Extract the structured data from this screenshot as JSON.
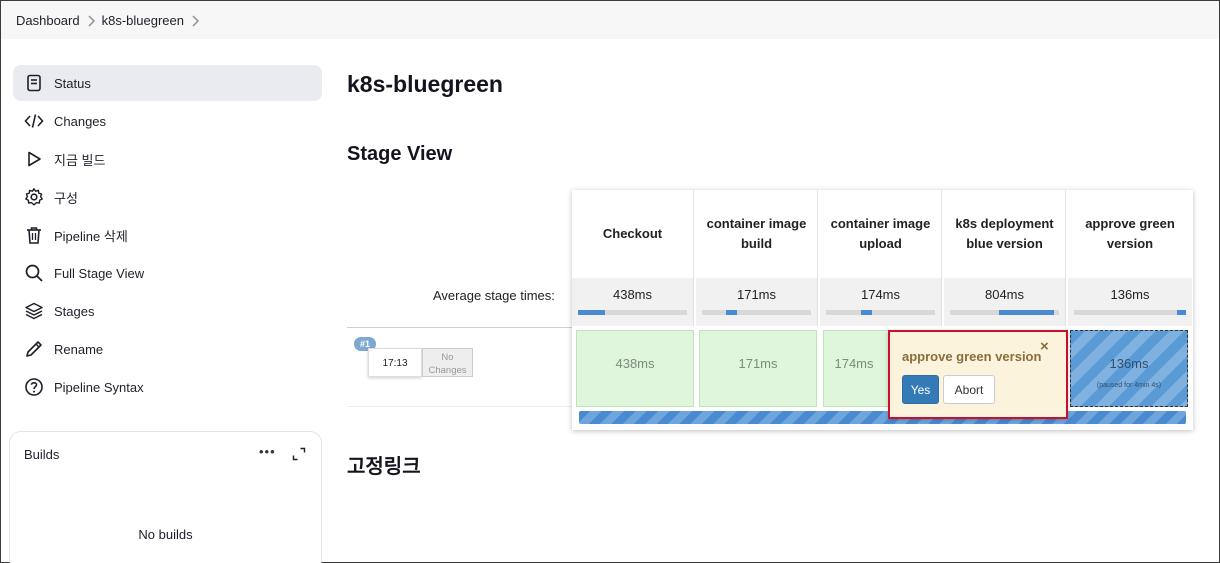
{
  "breadcrumb": [
    "Dashboard",
    "k8s-bluegreen"
  ],
  "sidebar": {
    "items": [
      {
        "label": "Status",
        "icon": "document-icon"
      },
      {
        "label": "Changes",
        "icon": "code-icon"
      },
      {
        "label": "지금 빌드",
        "icon": "play-icon"
      },
      {
        "label": "구성",
        "icon": "gear-icon"
      },
      {
        "label": "Pipeline 삭제",
        "icon": "trash-icon"
      },
      {
        "label": "Full Stage View",
        "icon": "search-icon"
      },
      {
        "label": "Stages",
        "icon": "layers-icon"
      },
      {
        "label": "Rename",
        "icon": "pencil-icon"
      },
      {
        "label": "Pipeline Syntax",
        "icon": "help-icon"
      }
    ],
    "active_item": "Status"
  },
  "builds": {
    "title": "Builds",
    "more": "•••",
    "empty_text": "No builds"
  },
  "main": {
    "title": "k8s-bluegreen",
    "stage_view_title": "Stage View",
    "permalinks_title": "고정링크"
  },
  "stage_view": {
    "avg_label": "Average stage times:",
    "stages": [
      {
        "name": "Checkout",
        "avg": "438ms",
        "avg_fraction": 0.25,
        "cell": "438ms"
      },
      {
        "name": "container image build",
        "avg": "171ms",
        "avg_fraction": 0.1,
        "cell": "171ms"
      },
      {
        "name": "container image upload",
        "avg": "174ms",
        "avg_fraction": 0.1,
        "cell": "174ms"
      },
      {
        "name": "k8s deployment blue version",
        "avg": "804ms",
        "avg_fraction": 0.5,
        "cell": ""
      },
      {
        "name": "approve green version",
        "avg": "136ms",
        "avg_fraction": 0.08,
        "cell": "136ms",
        "cell_sub": "(paused for 4min 4s)"
      }
    ],
    "build": {
      "number": "#1",
      "time": "17:13",
      "changes": "No Changes"
    },
    "progress_fraction": 1.0
  },
  "approve_popup": {
    "title": "approve green version",
    "close": "×",
    "yes_label": "Yes",
    "abort_label": "Abort"
  },
  "colors": {
    "success_cell": "#dff5dc",
    "paused_stripe": "#5b9bd5",
    "primary_button": "#337ab7",
    "popup_bg": "#fbf3dc",
    "popup_border": "#c8102e"
  }
}
